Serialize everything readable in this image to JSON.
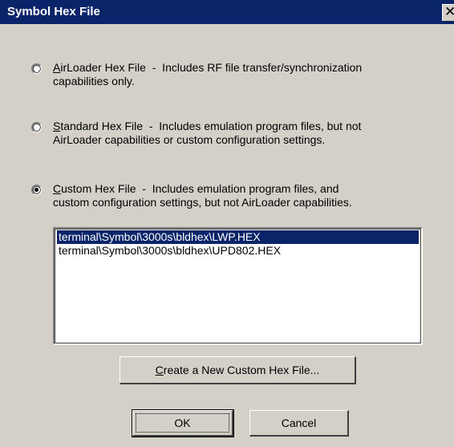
{
  "window": {
    "title": "Symbol Hex File",
    "close_glyph": "✕"
  },
  "options": [
    {
      "id": "airloader",
      "accel": "A",
      "label_rest": "irLoader Hex File",
      "line1_desc": "  -  Includes RF file transfer/synchronization",
      "line2": "capabilities only.",
      "checked": false
    },
    {
      "id": "standard",
      "accel": "S",
      "label_rest": "tandard Hex File",
      "line1_desc": "  -  Includes emulation program files, but not",
      "line2": "AirLoader capabilities or custom configuration settings.",
      "checked": false
    },
    {
      "id": "custom",
      "accel": "C",
      "label_rest": "ustom Hex File",
      "line1_desc": "  -  Includes emulation program files, and",
      "line2": "custom configuration settings, but not AirLoader capabilities.",
      "checked": true
    }
  ],
  "files": [
    {
      "path": "terminal\\Symbol\\3000s\\bldhex\\LWP.HEX",
      "selected": true
    },
    {
      "path": "terminal\\Symbol\\3000s\\bldhex\\UPD802.HEX",
      "selected": false
    }
  ],
  "buttons": {
    "create_accel": "C",
    "create_rest": "reate a New Custom Hex File...",
    "ok": "OK",
    "cancel": "Cancel"
  },
  "colors": {
    "titlebar": "#0a246a",
    "dialog_bg": "#d4d0c8",
    "selection": "#0a246a"
  }
}
